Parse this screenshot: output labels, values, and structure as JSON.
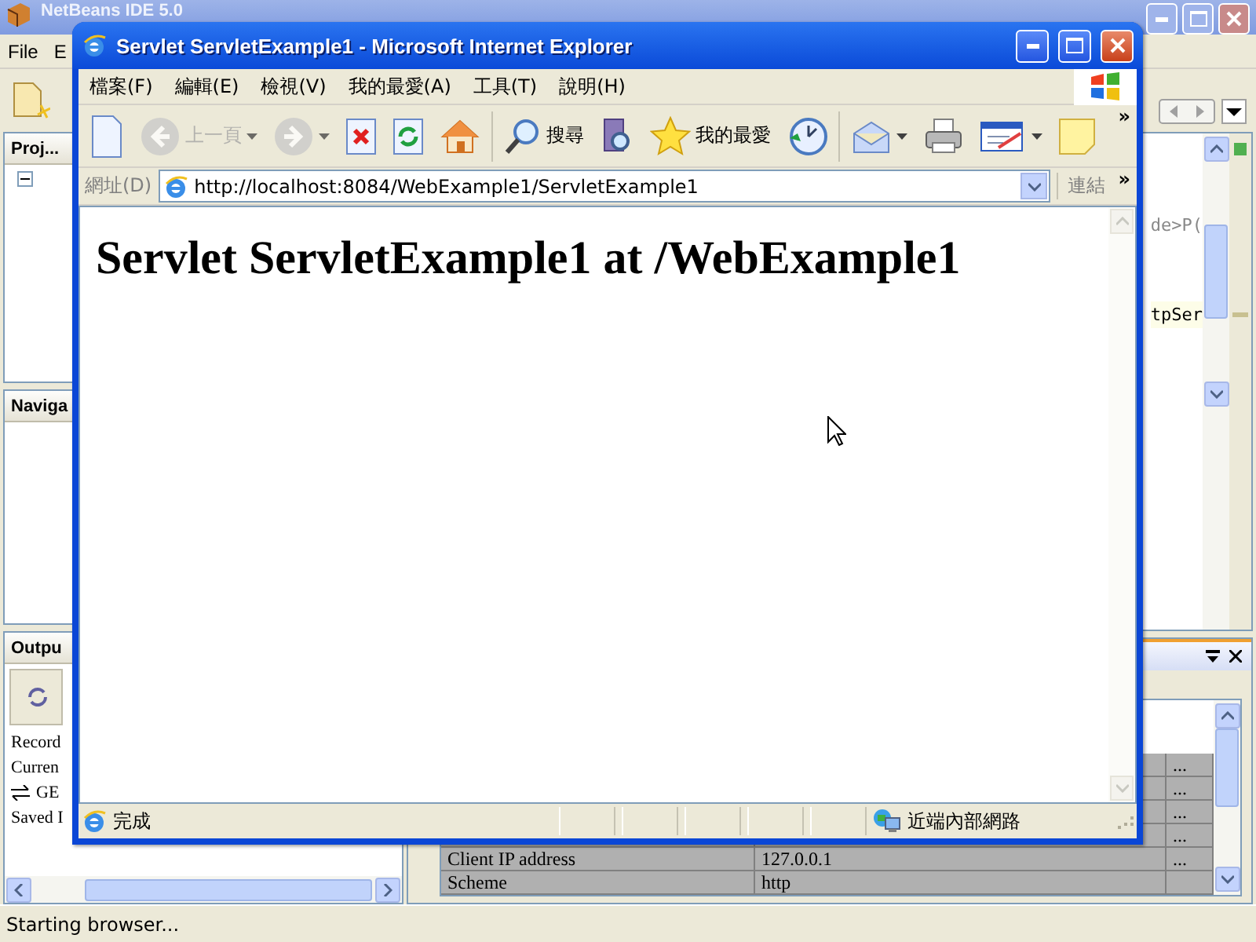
{
  "ide": {
    "title": "NetBeans IDE 5.0",
    "menu": [
      "File",
      "E"
    ],
    "panels": [
      {
        "title": "Proj..."
      },
      {
        "title": "Naviga"
      },
      {
        "title": "Outpu"
      }
    ],
    "output_lines": [
      {
        "kind": "text",
        "text": "Record"
      },
      {
        "kind": "text",
        "text": "Curren"
      },
      {
        "kind": "request",
        "text": "GE"
      },
      {
        "kind": "text",
        "text": "Saved I"
      }
    ],
    "editor_lines": [
      {
        "text": "de>P(",
        "highlighted": false
      },
      {
        "text": "tpSer",
        "highlighted": true
      }
    ],
    "table_rows": [
      {
        "more": "..."
      },
      {
        "more": "..."
      },
      {
        "more": "..."
      },
      {
        "more": "..."
      },
      {
        "name": "Client IP address",
        "value": "127.0.0.1",
        "more": "..."
      },
      {
        "name": "Scheme",
        "value": "http"
      }
    ],
    "status": "Starting browser..."
  },
  "browser": {
    "title": "Servlet ServletExample1 - Microsoft Internet Explorer",
    "menu": [
      "檔案(F)",
      "編輯(E)",
      "檢視(V)",
      "我的最愛(A)",
      "工具(T)",
      "說明(H)"
    ],
    "toolbar": [
      {
        "kind": "button",
        "disabled": false
      },
      {
        "kind": "button",
        "label": "上一頁",
        "disabled": true,
        "dropdown": true
      },
      {
        "kind": "button",
        "disabled": true,
        "dropdown": true
      },
      {
        "kind": "button",
        "disabled": false
      },
      {
        "kind": "button",
        "disabled": false
      },
      {
        "kind": "button",
        "disabled": false
      },
      {
        "kind": "separator"
      },
      {
        "kind": "button",
        "label": "搜尋",
        "disabled": false
      },
      {
        "kind": "button",
        "disabled": false
      },
      {
        "kind": "button",
        "label": "我的最愛",
        "disabled": false
      },
      {
        "kind": "button",
        "disabled": false
      },
      {
        "kind": "separator"
      },
      {
        "kind": "button",
        "disabled": false,
        "dropdown": true
      },
      {
        "kind": "button",
        "disabled": false
      },
      {
        "kind": "button",
        "disabled": false,
        "dropdown": true
      },
      {
        "kind": "button",
        "disabled": false
      }
    ],
    "toolbar_more": "»",
    "address_label": "網址(D)",
    "url": "http://localhost:8084/WebExample1/ServletExample1",
    "links_label": "連結",
    "links_more": "»",
    "heading": "Servlet ServletExample1 at /WebExample1",
    "status": "完成",
    "zone": "近端內部網路"
  }
}
